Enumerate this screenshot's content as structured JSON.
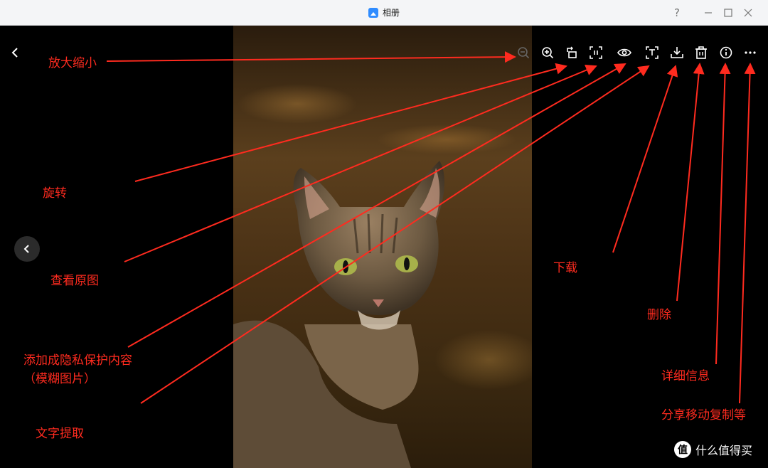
{
  "window": {
    "title": "相册",
    "help_label": "?",
    "accent": "#2f8cff"
  },
  "toolbar": {
    "icons": [
      "zoom-out-icon",
      "zoom-in-icon",
      "rotate-icon",
      "original-size-icon",
      "privacy-eye-icon",
      "text-extract-icon",
      "download-icon",
      "delete-icon",
      "info-icon",
      "more-icon"
    ]
  },
  "annotations": {
    "zoom": "放大缩小",
    "rotate": "旋转",
    "view_original": "查看原图",
    "privacy_line1": "添加成隐私保护内容",
    "privacy_line2": "（模糊图片）",
    "text_extract": "文字提取",
    "download": "下载",
    "delete": "删除",
    "details": "详细信息",
    "more": "分享移动复制等",
    "color": "#ff2b1f"
  },
  "watermark": {
    "logo_text": "值",
    "text": "什么值得买"
  }
}
